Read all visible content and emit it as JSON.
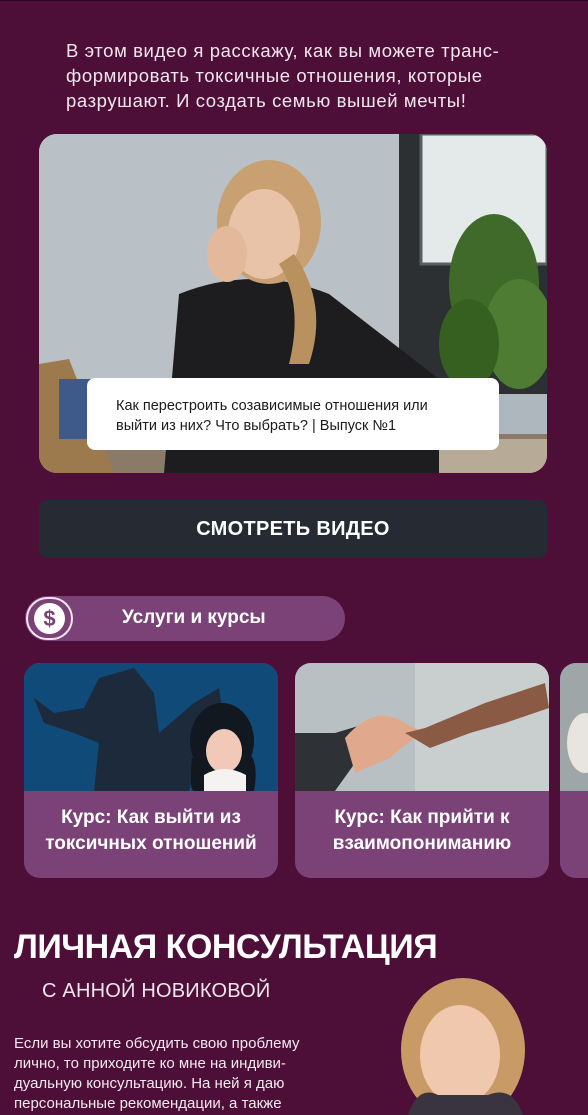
{
  "intro": {
    "line1": "В этом видео я расскажу, как вы можете транс-",
    "line2": "формировать токсичные отношения, которые",
    "line3": "разрушают. И создать семью вышей мечты!"
  },
  "video": {
    "caption_line1": "Как перестроить созависимые отношения или",
    "caption_line2": "выйти из них? Что выбрать? | Выпуск №1"
  },
  "watch_button": {
    "label": "СМОТРЕТЬ ВИДЕО"
  },
  "services": {
    "label": "Услуги и курсы",
    "icon": "dollar-icon"
  },
  "courses": [
    {
      "line1": "Курс: Как выйти из",
      "line2": "токсичных отношений"
    },
    {
      "line1": "Курс: Как прийти к",
      "line2": "взаимопониманию"
    }
  ],
  "consultation": {
    "title": "ЛИЧНАЯ КОНСУЛЬТАЦИЯ",
    "subtitle": "С АННОЙ НОВИКОВОЙ",
    "text_line1": "Если вы хотите обсудить свою проблему",
    "text_line2": "лично, то приходите ко мне на индиви-",
    "text_line3": "дуальную консультацию. На ней я даю",
    "text_line4": "персональные рекомендации, а также"
  },
  "colors": {
    "background": "#4d0f38",
    "accent": "#7a4276",
    "button": "#252a33"
  }
}
